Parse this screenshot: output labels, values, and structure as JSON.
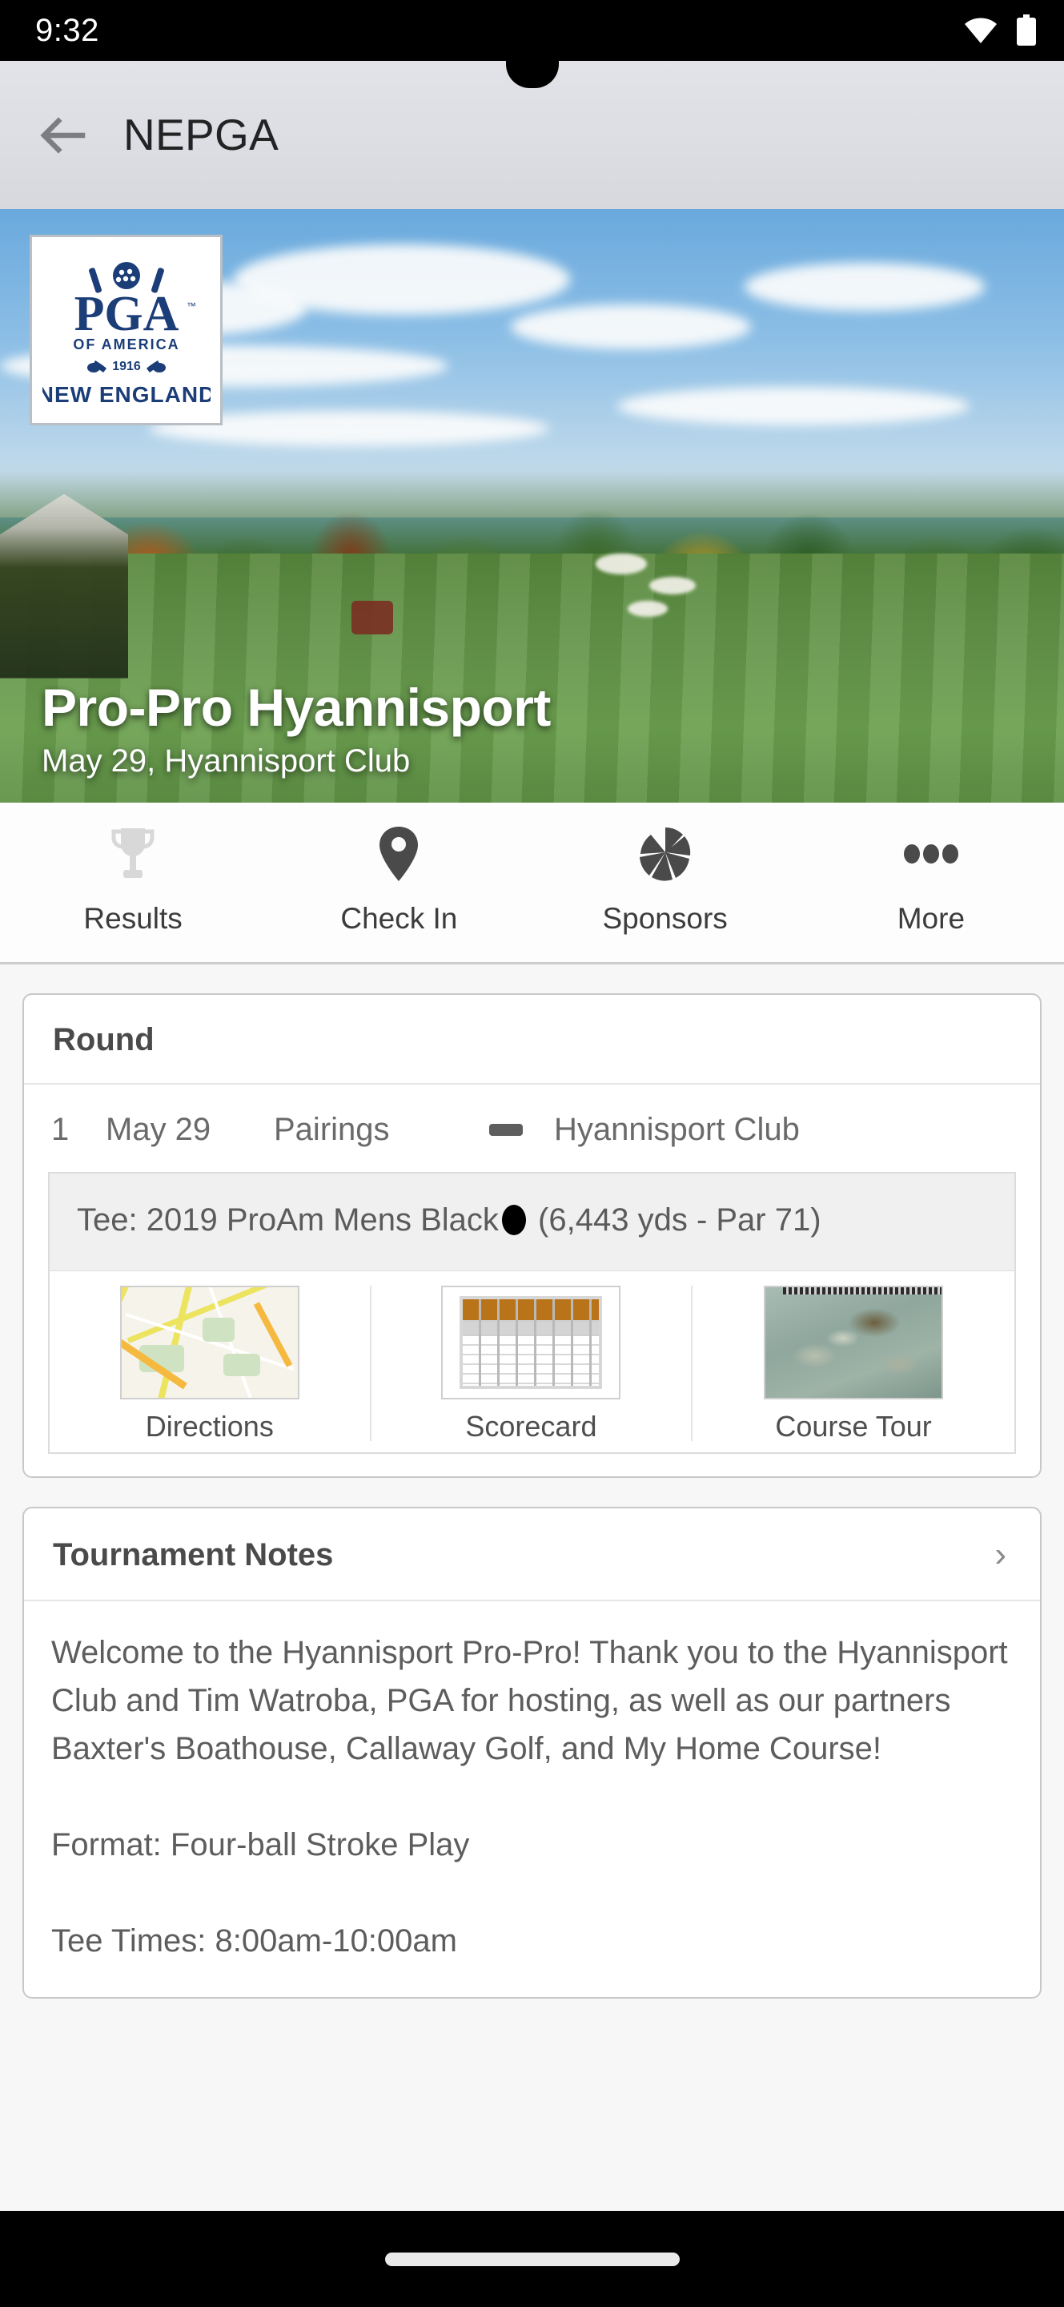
{
  "status_bar": {
    "time": "9:32",
    "wifi_icon": "wifi-icon",
    "battery_icon": "battery-full-icon"
  },
  "app_bar": {
    "back_icon": "back-arrow-icon",
    "title": "NEPGA"
  },
  "hero": {
    "logo_alt": "PGA of America New England",
    "logo": {
      "brand": "PGA",
      "line1": "OF AMERICA",
      "year": "1916",
      "section": "NEW ENGLAND"
    },
    "title": "Pro-Pro Hyannisport",
    "subtitle": "May 29, Hyannisport Club"
  },
  "tabs": [
    {
      "label": "Results",
      "icon": "trophy-icon",
      "state": "disabled"
    },
    {
      "label": "Check In",
      "icon": "map-pin-icon",
      "state": "enabled"
    },
    {
      "label": "Sponsors",
      "icon": "camera-aperture-icon",
      "state": "enabled"
    },
    {
      "label": "More",
      "icon": "ellipsis-icon",
      "state": "enabled"
    }
  ],
  "round_card": {
    "header": "Round",
    "row": {
      "number": "1",
      "date": "May 29",
      "pairings": "Pairings",
      "separator": "—",
      "course": "Hyannisport Club"
    },
    "tee_info": "Tee: 2019 ProAm Mens Black",
    "tee_color_swatch": "#000000",
    "tee_details": "(6,443 yds - Par 71)",
    "links": [
      {
        "label": "Directions",
        "icon": "map-thumbnail-icon"
      },
      {
        "label": "Scorecard",
        "icon": "scorecard-thumbnail-icon"
      },
      {
        "label": "Course Tour",
        "icon": "aerial-course-thumbnail-icon"
      }
    ]
  },
  "notes_card": {
    "header": "Tournament Notes",
    "chevron": "›",
    "body": "Welcome to the Hyannisport Pro-Pro! Thank you to the Hyannisport Club and Tim Watroba, PGA for hosting, as well as our partners Baxter's Boathouse, Callaway Golf, and My Home Course!\n\nFormat: Four-ball Stroke Play\n\nTee Times: 8:00am-10:00am"
  },
  "nav_bar": {
    "gesture_pill": "home-indicator"
  },
  "colors": {
    "accent_blue": "#1b3d78",
    "scorecard_orange": "#b9741a",
    "app_bar_bg": "#dcdde3",
    "page_bg": "#f7f7f7"
  }
}
